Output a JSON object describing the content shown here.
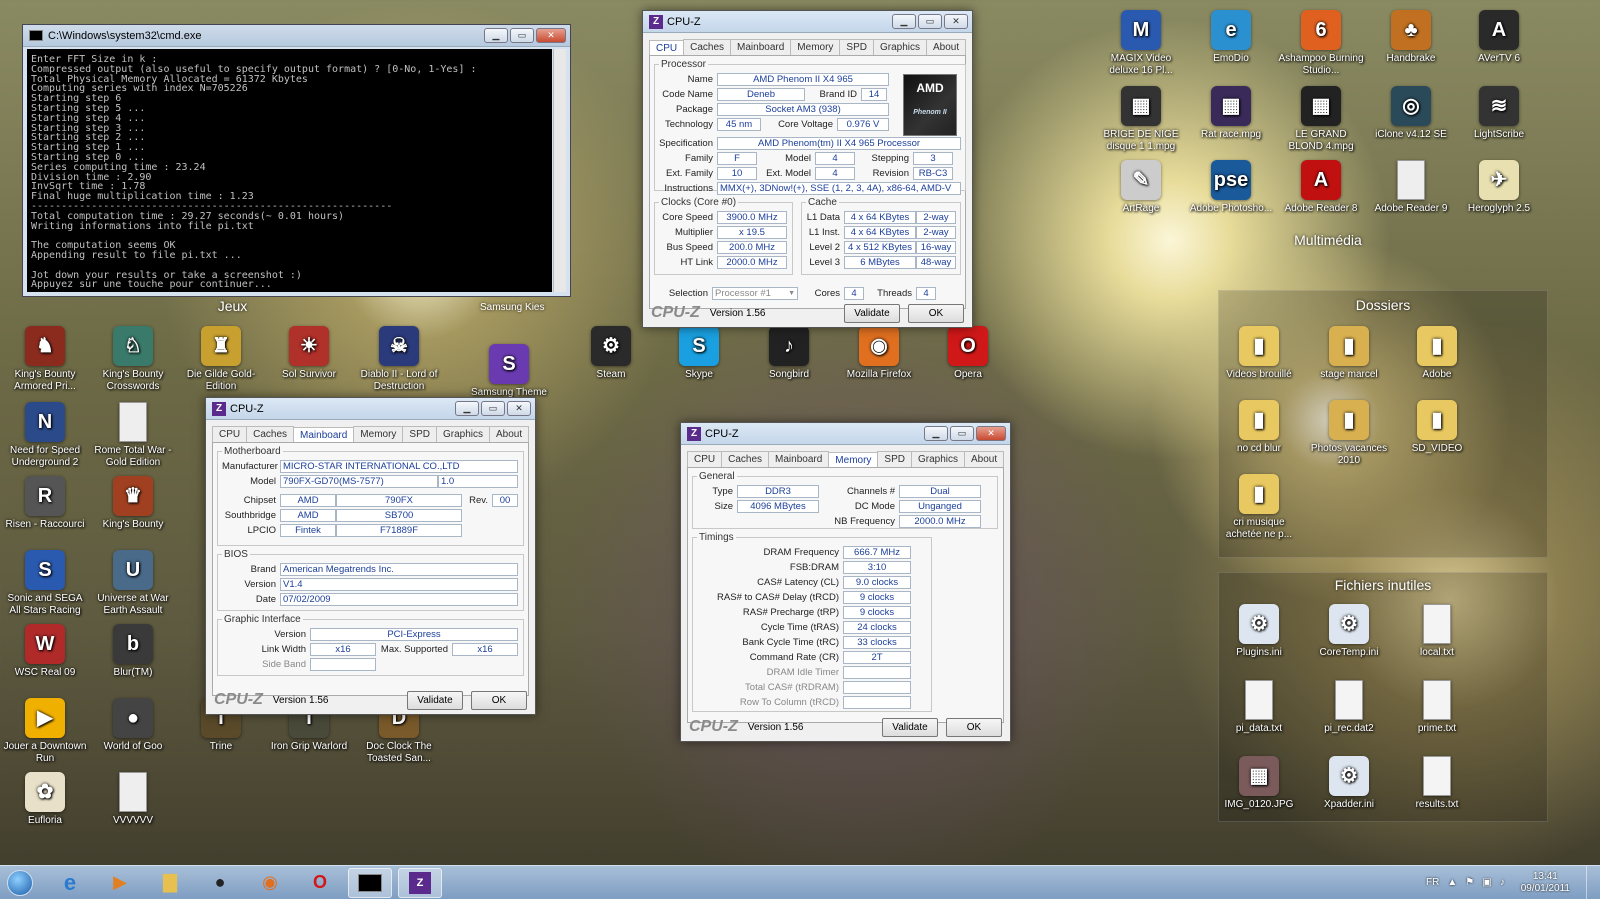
{
  "desktop": {
    "left_icons": [
      {
        "label": "King's Bounty Armored Pri...",
        "color": "#8b2b1e",
        "glyph": "♞"
      },
      {
        "label": "King's Bounty Crosswords",
        "color": "#3a7a6a",
        "glyph": "♘"
      },
      {
        "label": "Die Gilde Gold-Edition",
        "color": "#c8a030",
        "glyph": "♜"
      },
      {
        "label": "Sol Survivor",
        "color": "#b0302a",
        "glyph": "☀"
      },
      {
        "label": "Diablo II - Lord of Destruction",
        "color": "#2a3a7a",
        "glyph": "☠"
      },
      {
        "label": "Need for Speed Underground 2",
        "color": "#2a4a8a",
        "glyph": "N"
      },
      {
        "label": "Rome Total War - Gold Edition",
        "color": "#eeeeee",
        "glyph": ""
      },
      {
        "label": "Risen - Raccourci",
        "color": "#555",
        "glyph": "R"
      },
      {
        "label": "King's Bounty",
        "color": "#a04020",
        "glyph": "♛"
      },
      {
        "label": "Sonic and SEGA All Stars Racing",
        "color": "#2a5ab0",
        "glyph": "S"
      },
      {
        "label": "Universe at War Earth Assault",
        "color": "#4a6a8a",
        "glyph": "U"
      },
      {
        "label": "WSC Real 09",
        "color": "#b02a2a",
        "glyph": "W"
      },
      {
        "label": "Blur(TM)",
        "color": "#3a3a3a",
        "glyph": "b"
      },
      {
        "label": "Jouer a Downtown Run",
        "color": "#f0b000",
        "glyph": "▶"
      },
      {
        "label": "World of Goo",
        "color": "#444",
        "glyph": "●"
      },
      {
        "label": "Trine",
        "color": "#5a4a2a",
        "glyph": "T"
      },
      {
        "label": "Iron Grip Warlord",
        "color": "#4a4a3a",
        "glyph": "I"
      },
      {
        "label": "Doc Clock The Toasted San...",
        "color": "#7a5a2a",
        "glyph": "D"
      },
      {
        "label": "Eufloria",
        "color": "#e8e0c8",
        "glyph": "✿"
      },
      {
        "label": "VVVVVV",
        "color": "#eeeeee",
        "glyph": ""
      }
    ],
    "mid_icons": [
      {
        "label": "Samsung Theme",
        "color": "#6a3ab0",
        "glyph": "S"
      },
      {
        "label": "Steam",
        "color": "#2a2a2a",
        "glyph": "⚙"
      },
      {
        "label": "Skype",
        "color": "#1aa0e0",
        "glyph": "S"
      },
      {
        "label": "Songbird",
        "color": "#222",
        "glyph": "♪"
      },
      {
        "label": "Mozilla Firefox",
        "color": "#e07020",
        "glyph": "◉"
      },
      {
        "label": "Opera",
        "color": "#d01818",
        "glyph": "O"
      }
    ],
    "top_right_icons": [
      {
        "label": "MAGIX Video deluxe 16 Pl...",
        "color": "#2a5ab0",
        "glyph": "M"
      },
      {
        "label": "EmoDio",
        "color": "#2a90d0",
        "glyph": "e"
      },
      {
        "label": "Ashampoo Burning Studio...",
        "color": "#e06020",
        "glyph": "6"
      },
      {
        "label": "Handbrake",
        "color": "#c07020",
        "glyph": "♣"
      },
      {
        "label": "AVerTV 6",
        "color": "#2a2a2a",
        "glyph": "A"
      },
      {
        "label": "BRIGE DE NIGE disque 1 1.mpg",
        "color": "#333",
        "glyph": "▦"
      },
      {
        "label": "Rat race.mpg",
        "color": "#3a2a5a",
        "glyph": "▦"
      },
      {
        "label": "LE GRAND BLOND 4.mpg",
        "color": "#222",
        "glyph": "▦"
      },
      {
        "label": "iClone v4.12 SE",
        "color": "#2a4a5a",
        "glyph": "◎"
      },
      {
        "label": "LightScribe",
        "color": "#333",
        "glyph": "≋"
      },
      {
        "label": "ArtRage",
        "color": "#ccc",
        "glyph": "✎"
      },
      {
        "label": "Adobe Photosho...",
        "color": "#1a5a9a",
        "glyph": "pse"
      },
      {
        "label": "Adobe Reader 8",
        "color": "#c01010",
        "glyph": "A"
      },
      {
        "label": "Adobe Reader 9",
        "color": "#eeeeee",
        "glyph": ""
      },
      {
        "label": "Heroglyph 2.5",
        "color": "#e8e0b0",
        "glyph": "✈"
      }
    ],
    "fence_labels": {
      "multimedia": "Multimédia",
      "jeux": "Jeux",
      "samsung_kies": "Samsung Kies",
      "dossiers": "Dossiers",
      "fichiers": "Fichiers inutiles"
    },
    "dossiers": [
      {
        "label": "Videos brouillé",
        "color": "#e8c860",
        "glyph": "▮"
      },
      {
        "label": "stage marcel",
        "color": "#d8b050",
        "glyph": "▮"
      },
      {
        "label": "Adobe",
        "color": "#e8c860",
        "glyph": "▮"
      },
      {
        "label": "no cd blur",
        "color": "#e8c860",
        "glyph": "▮"
      },
      {
        "label": "Photos vacances 2010",
        "color": "#d8b050",
        "glyph": "▮"
      },
      {
        "label": "SD_VIDEO",
        "color": "#e8c860",
        "glyph": "▮"
      },
      {
        "label": "cri musique achetée ne p...",
        "color": "#e8c860",
        "glyph": "▮"
      }
    ],
    "fichiers": [
      {
        "label": "Plugins.ini",
        "color": "#dde6f0",
        "glyph": "⚙"
      },
      {
        "label": "CoreTemp.ini",
        "color": "#dde6f0",
        "glyph": "⚙"
      },
      {
        "label": "local.txt",
        "color": "#f4f4f4",
        "glyph": ""
      },
      {
        "label": "pi_data.txt",
        "color": "#f4f4f4",
        "glyph": ""
      },
      {
        "label": "pi_rec.dat2",
        "color": "#f4f4f4",
        "glyph": ""
      },
      {
        "label": "prime.txt",
        "color": "#f4f4f4",
        "glyph": ""
      },
      {
        "label": "IMG_0120.JPG",
        "color": "#7a5a5a",
        "glyph": "▦"
      },
      {
        "label": "Xpadder.ini",
        "color": "#dde6f0",
        "glyph": "⚙"
      },
      {
        "label": "results.txt",
        "color": "#f4f4f4",
        "glyph": ""
      }
    ]
  },
  "cmd": {
    "title": "C:\\Windows\\system32\\cmd.exe",
    "output": "Enter FFT Size in k :\nCompressed output (also useful to specify output format) ? [0-No, 1-Yes] :\nTotal Physical Memory Allocated = 61372 Kbytes\nComputing series with index N=705226\nStarting step 6\nStarting step 5 ...\nStarting step 4 ...\nStarting step 3 ...\nStarting step 2 ...\nStarting step 1 ...\nStarting step 0 ...\nSeries computing time : 23.24\nDivision time : 2.90\nInvSqrt time : 1.78\nFinal huge multiplication time : 1.23\n------------------------------------------------------------\nTotal computation time : 29.27 seconds(~ 0.01 hours)\nWriting informations into file pi.txt\n\nThe computation seems OK\nAppending result to file pi.txt ...\n\nJot down your results or take a screenshot :)\nAppuyez sur une touche pour continuer..."
  },
  "cpuz_tabs": [
    "CPU",
    "Caches",
    "Mainboard",
    "Memory",
    "SPD",
    "Graphics",
    "About"
  ],
  "cpuz_common": {
    "title": "CPU-Z",
    "brand": "CPU-Z",
    "version": "Version 1.56",
    "validate": "Validate",
    "ok": "OK"
  },
  "cpu": {
    "processor_legend": "Processor",
    "name_l": "Name",
    "name": "AMD Phenom II X4 965",
    "code_l": "Code Name",
    "code": "Deneb",
    "brandid_l": "Brand ID",
    "brandid": "14",
    "package_l": "Package",
    "package": "Socket AM3 (938)",
    "tech_l": "Technology",
    "tech": "45 nm",
    "cv_l": "Core Voltage",
    "cv": "0.976 V",
    "spec_l": "Specification",
    "spec": "AMD Phenom(tm) II X4 965 Processor",
    "family_l": "Family",
    "family": "F",
    "model_l": "Model",
    "model": "4",
    "stepping_l": "Stepping",
    "stepping": "3",
    "extfam_l": "Ext. Family",
    "extfam": "10",
    "extmod_l": "Ext. Model",
    "extmod": "4",
    "rev_l": "Revision",
    "rev": "RB-C3",
    "instr_l": "Instructions",
    "instr": "MMX(+), 3DNow!(+), SSE (1, 2, 3, 4A), x86-64, AMD-V",
    "clocks_legend": "Clocks (Core #0)",
    "cs_l": "Core Speed",
    "cs": "3900.0 MHz",
    "mult_l": "Multiplier",
    "mult": "x 19.5",
    "bus_l": "Bus Speed",
    "bus": "200.0 MHz",
    "ht_l": "HT Link",
    "ht": "2000.0 MHz",
    "cache_legend": "Cache",
    "l1d_l": "L1 Data",
    "l1d": "4 x 64 KBytes",
    "l1d_w": "2-way",
    "l1i_l": "L1 Inst.",
    "l1i": "4 x 64 KBytes",
    "l1i_w": "2-way",
    "l2_l": "Level 2",
    "l2": "4 x 512 KBytes",
    "l2_w": "16-way",
    "l3_l": "Level 3",
    "l3": "6 MBytes",
    "l3_w": "48-way",
    "sel_l": "Selection",
    "sel": "Processor #1",
    "cores_l": "Cores",
    "cores": "4",
    "threads_l": "Threads",
    "threads": "4",
    "logo_top": "AMD",
    "logo_bottom": "Phenom II"
  },
  "mb": {
    "mb_legend": "Motherboard",
    "man_l": "Manufacturer",
    "man": "MICRO-STAR INTERNATIONAL CO.,LTD",
    "model_l": "Model",
    "model": "790FX-GD70(MS-7577)",
    "model_rev": "1.0",
    "chip_l": "Chipset",
    "chip_v": "AMD",
    "chip_m": "790FX",
    "chip_rev_l": "Rev.",
    "chip_rev": "00",
    "sb_l": "Southbridge",
    "sb_v": "AMD",
    "sb_m": "SB700",
    "lpc_l": "LPCIO",
    "lpc_v": "Fintek",
    "lpc_m": "F71889F",
    "bios_legend": "BIOS",
    "brand_l": "Brand",
    "brand": "American Megatrends Inc.",
    "ver_l": "Version",
    "ver": "V1.4",
    "date_l": "Date",
    "date": "07/02/2009",
    "gi_legend": "Graphic Interface",
    "giv_l": "Version",
    "giv": "PCI-Express",
    "lw_l": "Link Width",
    "lw": "x16",
    "ms_l": "Max. Supported",
    "ms": "x16",
    "sb2_l": "Side Band"
  },
  "mem": {
    "gen_legend": "General",
    "type_l": "Type",
    "type": "DDR3",
    "ch_l": "Channels #",
    "ch": "Dual",
    "size_l": "Size",
    "size": "4096 MBytes",
    "dc_l": "DC Mode",
    "dc": "Unganged",
    "nb_l": "NB Frequency",
    "nb": "2000.0 MHz",
    "tim_legend": "Timings",
    "t": [
      {
        "l": "DRAM Frequency",
        "v": "666.7 MHz"
      },
      {
        "l": "FSB:DRAM",
        "v": "3:10"
      },
      {
        "l": "CAS# Latency (CL)",
        "v": "9.0 clocks"
      },
      {
        "l": "RAS# to CAS# Delay (tRCD)",
        "v": "9 clocks"
      },
      {
        "l": "RAS# Precharge (tRP)",
        "v": "9 clocks"
      },
      {
        "l": "Cycle Time (tRAS)",
        "v": "24 clocks"
      },
      {
        "l": "Bank Cycle Time (tRC)",
        "v": "33 clocks"
      },
      {
        "l": "Command Rate (CR)",
        "v": "2T"
      },
      {
        "l": "DRAM Idle Timer",
        "v": ""
      },
      {
        "l": "Total CAS# (tRDRAM)",
        "v": ""
      },
      {
        "l": "Row To Column (tRCD)",
        "v": ""
      }
    ]
  },
  "taskbar": {
    "lang": "FR",
    "time": "13:41",
    "date": "09/01/2011"
  }
}
